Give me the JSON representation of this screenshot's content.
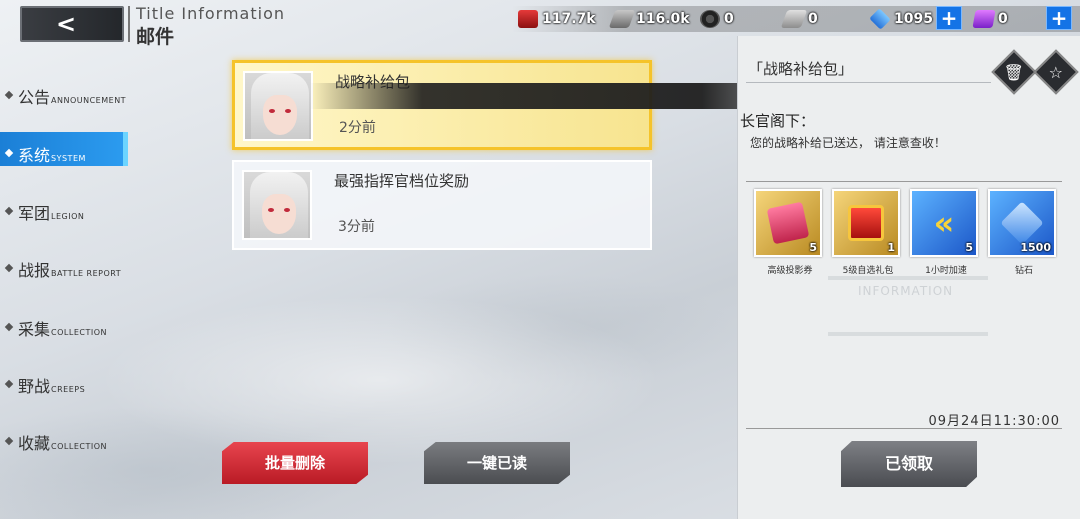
{
  "header": {
    "back_symbol": "<",
    "title_en": "Title Information",
    "title_cn": "邮件"
  },
  "resources": [
    {
      "icon": "fuel-icon",
      "value": "117.7k"
    },
    {
      "icon": "steel-icon",
      "value": "116.0k"
    },
    {
      "icon": "tire-icon",
      "value": "0"
    },
    {
      "icon": "alloy-icon",
      "value": "0"
    },
    {
      "icon": "diamond-icon",
      "value": "1095"
    },
    {
      "icon": "crystal-icon",
      "value": "0"
    }
  ],
  "plus_label": "+",
  "nav": [
    {
      "cn": "公告",
      "en": "ANNOUNCEMENT"
    },
    {
      "cn": "系统",
      "en": "SYSTEM"
    },
    {
      "cn": "军团",
      "en": "LEGION"
    },
    {
      "cn": "战报",
      "en": "BATTLE REPORT"
    },
    {
      "cn": "采集",
      "en": "COLLECTION"
    },
    {
      "cn": "野战",
      "en": "CREEPS"
    },
    {
      "cn": "收藏",
      "en": "COLLECTION"
    }
  ],
  "nav_active_index": 1,
  "mails": [
    {
      "title": "战略补给包",
      "time": "2分前",
      "selected": true
    },
    {
      "title": "最强指挥官档位奖励",
      "time": "3分前",
      "selected": false
    }
  ],
  "actions": {
    "delete_label": "批量删除",
    "read_all_label": "一键已读"
  },
  "detail": {
    "title": "「战略补给包」",
    "delete_icon": "trash-icon",
    "star_icon": "star-icon",
    "greeting": "长官阁下：",
    "body": "您的战略补给已送达，  请注意查收！",
    "attachments": [
      {
        "name": "高级投影券",
        "count": "5",
        "icon": "ticket-icon"
      },
      {
        "name": "5级自选礼包",
        "count": "1",
        "icon": "gift-icon"
      },
      {
        "name": "1小时加速",
        "count": "5",
        "icon": "speedup-icon"
      },
      {
        "name": "钻石",
        "count": "1500",
        "icon": "diamond-icon"
      }
    ],
    "watermark": "INFORMATION",
    "date": "09月24日11:30:00",
    "claim_label": "已领取"
  },
  "colors": {
    "accent_blue": "#1b7fd6",
    "selected_gold": "#f5c32a",
    "delete_red": "#d0303a"
  }
}
